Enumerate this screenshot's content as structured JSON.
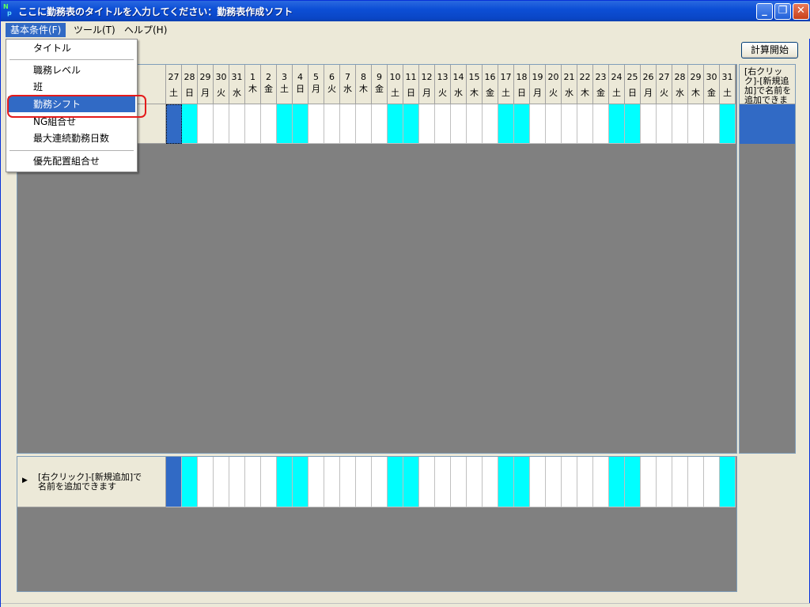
{
  "window": {
    "title": "ここに勤務表のタイトルを入力してください：勤務表作成ソフト",
    "icon_text_top": "N",
    "icon_text_bottom": "p",
    "controls": {
      "minimize": "_",
      "restore": "❐",
      "close": "✕"
    }
  },
  "menubar": {
    "items": [
      {
        "label": "基本条件(F)",
        "active": true
      },
      {
        "label": "ツール(T)",
        "active": false
      },
      {
        "label": "ヘルプ(H)",
        "active": false
      }
    ]
  },
  "dropdown": {
    "items": [
      {
        "label": "タイトル"
      },
      {
        "label": "職務レベル"
      },
      {
        "label": "班"
      },
      {
        "label": "勤務シフト",
        "active": true
      },
      {
        "label": "NG組合せ"
      },
      {
        "label": "最大連続勤務日数"
      },
      {
        "label": "優先配置組合せ"
      }
    ]
  },
  "toolbar": {
    "calc_label": "計算開始"
  },
  "calendar": {
    "days": [
      {
        "d": "27",
        "w": "土",
        "type": "blue"
      },
      {
        "d": "28",
        "w": "日",
        "type": "we"
      },
      {
        "d": "29",
        "w": "月",
        "type": "wd"
      },
      {
        "d": "30",
        "w": "火",
        "type": "wd"
      },
      {
        "d": "31",
        "w": "水",
        "type": "wd"
      },
      {
        "d": "1",
        "w": "木",
        "type": "wd"
      },
      {
        "d": "2",
        "w": "金",
        "type": "wd"
      },
      {
        "d": "3",
        "w": "土",
        "type": "we"
      },
      {
        "d": "4",
        "w": "日",
        "type": "we"
      },
      {
        "d": "5",
        "w": "月",
        "type": "wd"
      },
      {
        "d": "6",
        "w": "火",
        "type": "wd"
      },
      {
        "d": "7",
        "w": "水",
        "type": "wd"
      },
      {
        "d": "8",
        "w": "木",
        "type": "wd"
      },
      {
        "d": "9",
        "w": "金",
        "type": "wd"
      },
      {
        "d": "10",
        "w": "土",
        "type": "we"
      },
      {
        "d": "11",
        "w": "日",
        "type": "we"
      },
      {
        "d": "12",
        "w": "月",
        "type": "wd"
      },
      {
        "d": "13",
        "w": "火",
        "type": "wd"
      },
      {
        "d": "14",
        "w": "水",
        "type": "wd"
      },
      {
        "d": "15",
        "w": "木",
        "type": "wd"
      },
      {
        "d": "16",
        "w": "金",
        "type": "wd"
      },
      {
        "d": "17",
        "w": "土",
        "type": "we"
      },
      {
        "d": "18",
        "w": "日",
        "type": "we"
      },
      {
        "d": "19",
        "w": "月",
        "type": "wd"
      },
      {
        "d": "20",
        "w": "火",
        "type": "wd"
      },
      {
        "d": "21",
        "w": "水",
        "type": "wd"
      },
      {
        "d": "22",
        "w": "木",
        "type": "wd"
      },
      {
        "d": "23",
        "w": "金",
        "type": "wd"
      },
      {
        "d": "24",
        "w": "土",
        "type": "we"
      },
      {
        "d": "25",
        "w": "日",
        "type": "we"
      },
      {
        "d": "26",
        "w": "月",
        "type": "wd"
      },
      {
        "d": "27",
        "w": "火",
        "type": "wd"
      },
      {
        "d": "28",
        "w": "水",
        "type": "wd"
      },
      {
        "d": "29",
        "w": "木",
        "type": "wd"
      },
      {
        "d": "30",
        "w": "金",
        "type": "wd"
      },
      {
        "d": "31",
        "w": "土",
        "type": "we"
      }
    ]
  },
  "side_panel": {
    "header_text": "[右クリック]-[新規追加]で名前を追加できます"
  },
  "bottom_grid": {
    "arrow": "▶",
    "row_hint_line1": "[右クリック]-[新規追加]で",
    "row_hint_line2": "名前を追加できます"
  },
  "colors": {
    "selection": "#316ac5",
    "weekend": "#00ffff",
    "empty_area": "#808080",
    "highlight_ring": "#e41b1b"
  }
}
